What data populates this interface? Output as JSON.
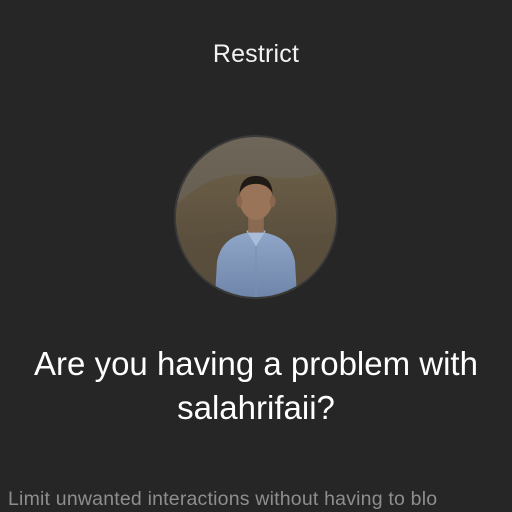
{
  "header": {
    "title": "Restrict"
  },
  "profile": {
    "avatar_icon": "profile-photo"
  },
  "prompt": {
    "line1": "Are you having a problem with",
    "line2": "salahrifaii?"
  },
  "description": {
    "text": "Limit unwanted interactions without having to blo"
  },
  "colors": {
    "background": "#262626",
    "primary_text": "#ffffff",
    "secondary_text": "#8e8e8e"
  }
}
